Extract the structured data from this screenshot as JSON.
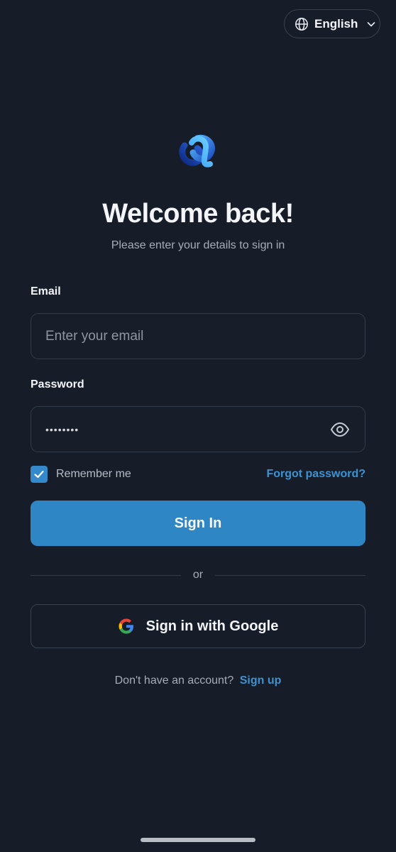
{
  "language": {
    "label": "English"
  },
  "header": {
    "title": "Welcome back!",
    "subtitle": "Please enter your details to sign in"
  },
  "email": {
    "label": "Email",
    "placeholder": "Enter your email",
    "value": ""
  },
  "password": {
    "label": "Password",
    "value": "••••••••"
  },
  "remember": {
    "label": "Remember me",
    "checked": true
  },
  "forgot_label": "Forgot password?",
  "signin_label": "Sign In",
  "divider_label": "or",
  "google_label": "Sign in with Google",
  "signup": {
    "prompt": "Don't have an account?",
    "link": "Sign up"
  },
  "colors": {
    "background": "#161d28",
    "accent": "#2f86c5",
    "link": "#3d93d1"
  },
  "icons": {
    "language": "globe-icon",
    "dropdown": "chevron-down-icon",
    "logo": "knot-logo",
    "password_toggle": "eye-icon",
    "checkbox": "checkmark-icon",
    "google": "google-icon"
  }
}
